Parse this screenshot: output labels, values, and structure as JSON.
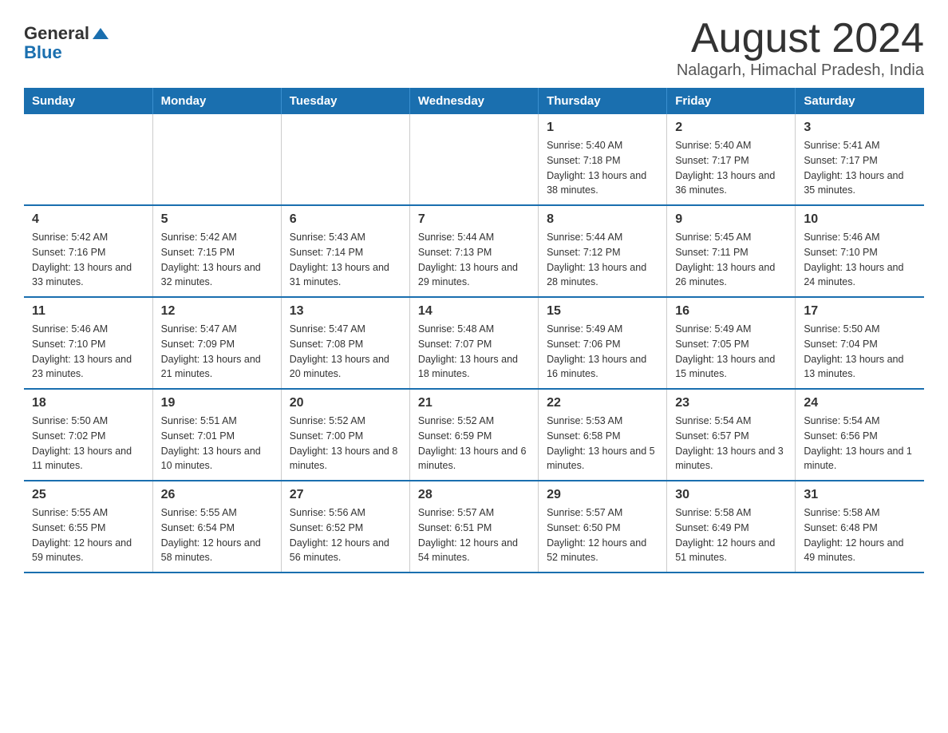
{
  "header": {
    "logo_general": "General",
    "logo_blue": "Blue",
    "title": "August 2024",
    "subtitle": "Nalagarh, Himachal Pradesh, India"
  },
  "days_of_week": [
    "Sunday",
    "Monday",
    "Tuesday",
    "Wednesday",
    "Thursday",
    "Friday",
    "Saturday"
  ],
  "weeks": [
    [
      {
        "day": "",
        "info": ""
      },
      {
        "day": "",
        "info": ""
      },
      {
        "day": "",
        "info": ""
      },
      {
        "day": "",
        "info": ""
      },
      {
        "day": "1",
        "info": "Sunrise: 5:40 AM\nSunset: 7:18 PM\nDaylight: 13 hours and 38 minutes."
      },
      {
        "day": "2",
        "info": "Sunrise: 5:40 AM\nSunset: 7:17 PM\nDaylight: 13 hours and 36 minutes."
      },
      {
        "day": "3",
        "info": "Sunrise: 5:41 AM\nSunset: 7:17 PM\nDaylight: 13 hours and 35 minutes."
      }
    ],
    [
      {
        "day": "4",
        "info": "Sunrise: 5:42 AM\nSunset: 7:16 PM\nDaylight: 13 hours and 33 minutes."
      },
      {
        "day": "5",
        "info": "Sunrise: 5:42 AM\nSunset: 7:15 PM\nDaylight: 13 hours and 32 minutes."
      },
      {
        "day": "6",
        "info": "Sunrise: 5:43 AM\nSunset: 7:14 PM\nDaylight: 13 hours and 31 minutes."
      },
      {
        "day": "7",
        "info": "Sunrise: 5:44 AM\nSunset: 7:13 PM\nDaylight: 13 hours and 29 minutes."
      },
      {
        "day": "8",
        "info": "Sunrise: 5:44 AM\nSunset: 7:12 PM\nDaylight: 13 hours and 28 minutes."
      },
      {
        "day": "9",
        "info": "Sunrise: 5:45 AM\nSunset: 7:11 PM\nDaylight: 13 hours and 26 minutes."
      },
      {
        "day": "10",
        "info": "Sunrise: 5:46 AM\nSunset: 7:10 PM\nDaylight: 13 hours and 24 minutes."
      }
    ],
    [
      {
        "day": "11",
        "info": "Sunrise: 5:46 AM\nSunset: 7:10 PM\nDaylight: 13 hours and 23 minutes."
      },
      {
        "day": "12",
        "info": "Sunrise: 5:47 AM\nSunset: 7:09 PM\nDaylight: 13 hours and 21 minutes."
      },
      {
        "day": "13",
        "info": "Sunrise: 5:47 AM\nSunset: 7:08 PM\nDaylight: 13 hours and 20 minutes."
      },
      {
        "day": "14",
        "info": "Sunrise: 5:48 AM\nSunset: 7:07 PM\nDaylight: 13 hours and 18 minutes."
      },
      {
        "day": "15",
        "info": "Sunrise: 5:49 AM\nSunset: 7:06 PM\nDaylight: 13 hours and 16 minutes."
      },
      {
        "day": "16",
        "info": "Sunrise: 5:49 AM\nSunset: 7:05 PM\nDaylight: 13 hours and 15 minutes."
      },
      {
        "day": "17",
        "info": "Sunrise: 5:50 AM\nSunset: 7:04 PM\nDaylight: 13 hours and 13 minutes."
      }
    ],
    [
      {
        "day": "18",
        "info": "Sunrise: 5:50 AM\nSunset: 7:02 PM\nDaylight: 13 hours and 11 minutes."
      },
      {
        "day": "19",
        "info": "Sunrise: 5:51 AM\nSunset: 7:01 PM\nDaylight: 13 hours and 10 minutes."
      },
      {
        "day": "20",
        "info": "Sunrise: 5:52 AM\nSunset: 7:00 PM\nDaylight: 13 hours and 8 minutes."
      },
      {
        "day": "21",
        "info": "Sunrise: 5:52 AM\nSunset: 6:59 PM\nDaylight: 13 hours and 6 minutes."
      },
      {
        "day": "22",
        "info": "Sunrise: 5:53 AM\nSunset: 6:58 PM\nDaylight: 13 hours and 5 minutes."
      },
      {
        "day": "23",
        "info": "Sunrise: 5:54 AM\nSunset: 6:57 PM\nDaylight: 13 hours and 3 minutes."
      },
      {
        "day": "24",
        "info": "Sunrise: 5:54 AM\nSunset: 6:56 PM\nDaylight: 13 hours and 1 minute."
      }
    ],
    [
      {
        "day": "25",
        "info": "Sunrise: 5:55 AM\nSunset: 6:55 PM\nDaylight: 12 hours and 59 minutes."
      },
      {
        "day": "26",
        "info": "Sunrise: 5:55 AM\nSunset: 6:54 PM\nDaylight: 12 hours and 58 minutes."
      },
      {
        "day": "27",
        "info": "Sunrise: 5:56 AM\nSunset: 6:52 PM\nDaylight: 12 hours and 56 minutes."
      },
      {
        "day": "28",
        "info": "Sunrise: 5:57 AM\nSunset: 6:51 PM\nDaylight: 12 hours and 54 minutes."
      },
      {
        "day": "29",
        "info": "Sunrise: 5:57 AM\nSunset: 6:50 PM\nDaylight: 12 hours and 52 minutes."
      },
      {
        "day": "30",
        "info": "Sunrise: 5:58 AM\nSunset: 6:49 PM\nDaylight: 12 hours and 51 minutes."
      },
      {
        "day": "31",
        "info": "Sunrise: 5:58 AM\nSunset: 6:48 PM\nDaylight: 12 hours and 49 minutes."
      }
    ]
  ]
}
